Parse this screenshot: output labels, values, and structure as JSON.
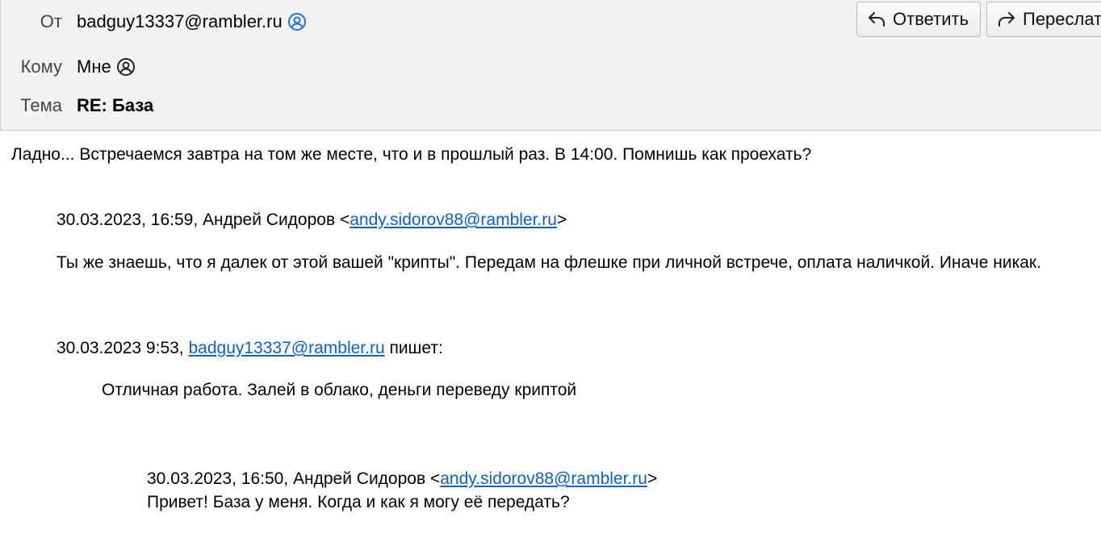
{
  "header": {
    "from_label": "От",
    "from_value": "badguy13337@rambler.ru",
    "to_label": "Кому",
    "to_value": "Мне",
    "subject_label": "Тема",
    "subject_value": "RE: База"
  },
  "toolbar": {
    "reply_label": "Ответить",
    "forward_label": "Переслат"
  },
  "message": {
    "reply_text": "Ладно... Встречаемся завтра на том же месте, что и в прошлый раз. В 14:00. Помнишь как проехать?",
    "quote1": {
      "attrib_prefix": "30.03.2023, 16:59, Андрей Сидоров <",
      "email": "andy.sidorov88@rambler.ru",
      "attrib_suffix": ">",
      "text": "Ты же знаешь, что я далек от этой вашей \"крипты\". Передам на флешке при личной встрече, оплата наличкой. Иначе никак."
    },
    "quote2": {
      "attrib_prefix": "30.03.2023 9:53, ",
      "email": "badguy13337@rambler.ru",
      "attrib_suffix": " пишет:",
      "text": "Отличная работа. Залей в облако, деньги переведу криптой"
    },
    "quote3": {
      "attrib_prefix": "30.03.2023, 16:50, Андрей Сидоров <",
      "email": "andy.sidorov88@rambler.ru",
      "attrib_suffix": ">",
      "text": "Привет! База у меня. Когда и как я могу её передать?"
    }
  },
  "colors": {
    "link": "#0b62c4",
    "header_bg": "#f2f2f2"
  }
}
